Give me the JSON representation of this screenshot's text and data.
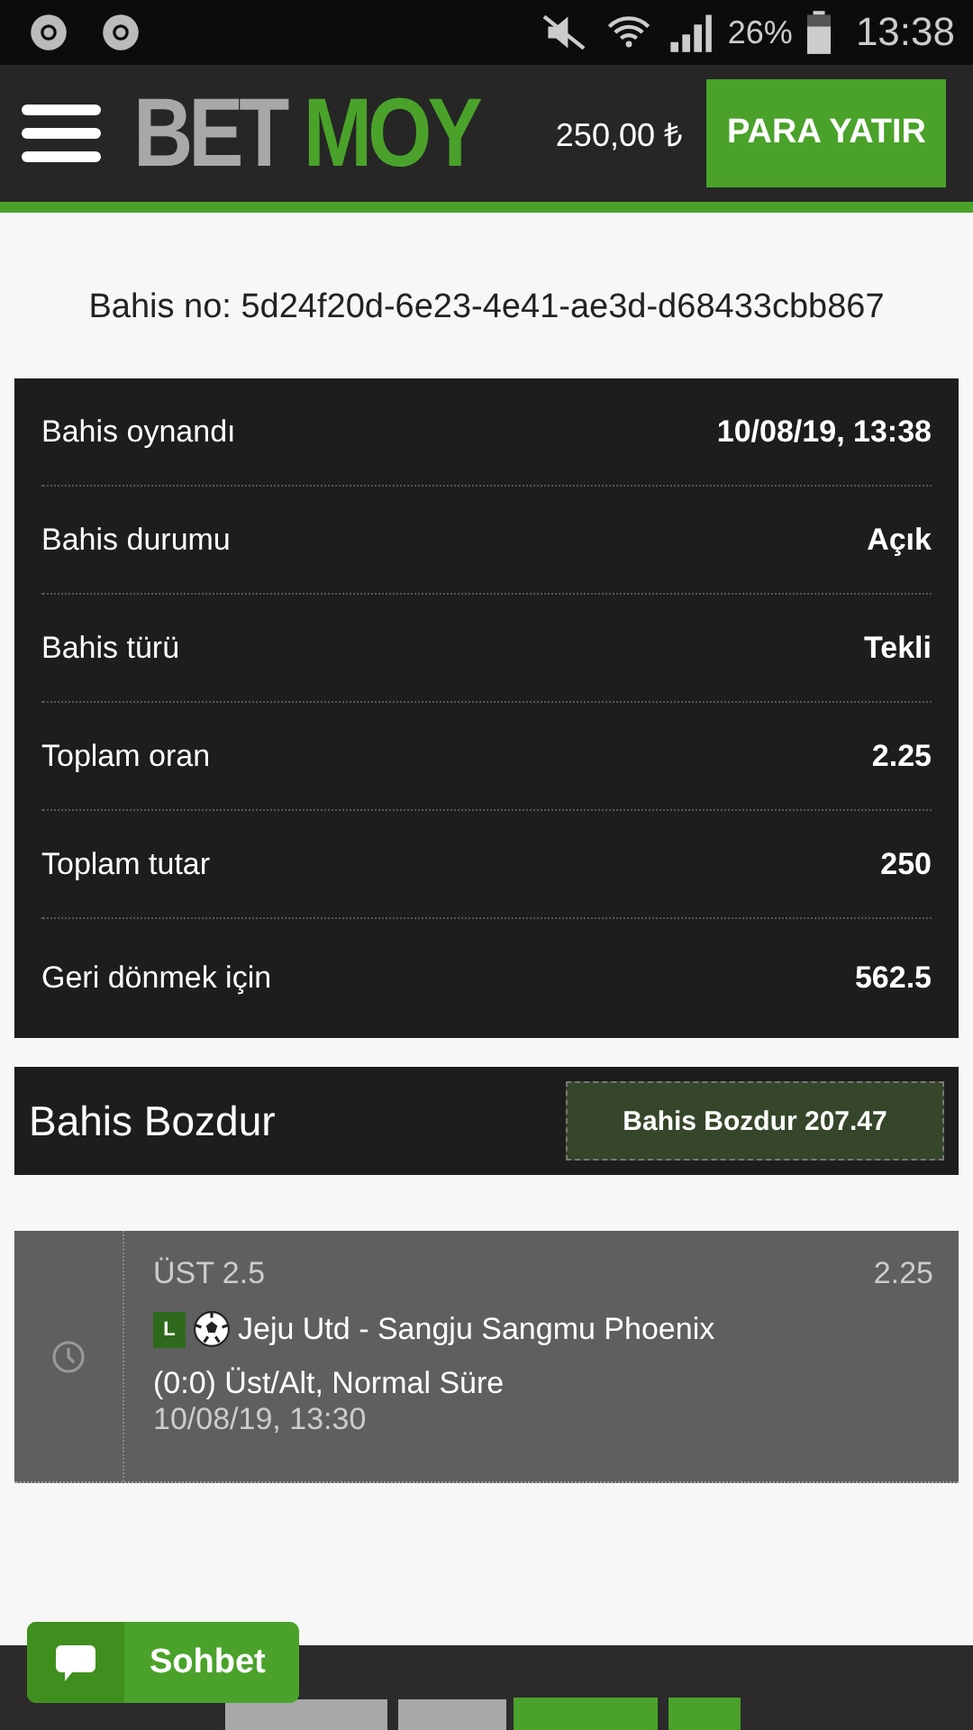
{
  "status_bar": {
    "battery": "26%",
    "time": "13:38"
  },
  "header": {
    "logo": {
      "first": "BET",
      "second": "MOY"
    },
    "balance": "250,00 ₺",
    "deposit_button": "PARA YATIR"
  },
  "bet_id": "Bahis no: 5d24f20d-6e23-4e41-ae3d-d68433cbb867",
  "details": [
    {
      "label": "Bahis oynandı",
      "value": "10/08/19, 13:38"
    },
    {
      "label": "Bahis durumu",
      "value": "Açık"
    },
    {
      "label": "Bahis türü",
      "value": "Tekli"
    },
    {
      "label": "Toplam oran",
      "value": "2.25"
    },
    {
      "label": "Toplam tutar",
      "value": "250"
    },
    {
      "label": "Geri dönmek için",
      "value": "562.5"
    }
  ],
  "cashout": {
    "title": "Bahis Bozdur",
    "button": "Bahis Bozdur 207.47"
  },
  "selection": {
    "market": "ÜST 2.5",
    "odds": "2.25",
    "live_badge": "L",
    "match": "Jeju Utd - Sangju Sangmu Phoenix",
    "bet_type": "(0:0) Üst/Alt, Normal Süre",
    "date": "10/08/19, 13:30"
  },
  "chat_button": "Sohbet"
}
